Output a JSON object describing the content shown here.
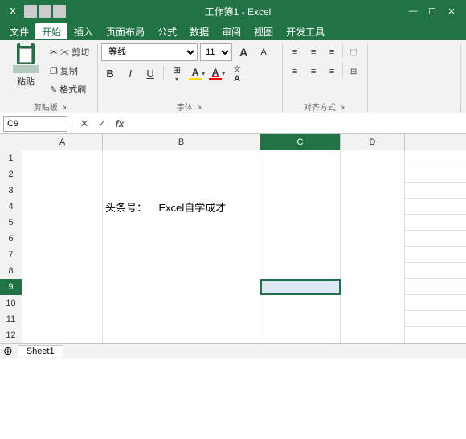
{
  "titlebar": {
    "text": "工作簿1 - Excel",
    "controls": [
      "—",
      "☐",
      "✕"
    ]
  },
  "menubar": {
    "items": [
      "文件",
      "开始",
      "插入",
      "页面布局",
      "公式",
      "数据",
      "审阅",
      "视图",
      "开发工具"
    ],
    "active": 1
  },
  "ribbon": {
    "clipboard": {
      "label": "剪贴板",
      "paste_label": "粘贴",
      "cut_label": "✂ 剪切",
      "copy_label": "☐ 复制",
      "format_label": "✎ 格式刷"
    },
    "font": {
      "label": "字体",
      "font_name": "等线",
      "font_size": "11",
      "bold": "B",
      "italic": "I",
      "underline": "U",
      "border_btn": "⊞",
      "fill_btn": "A",
      "color_btn": "A",
      "increase_size": "A",
      "decrease_size": "A"
    },
    "alignment": {
      "label": "对齐方式",
      "align_top": "≡",
      "align_mid": "≡",
      "align_bot": "≡",
      "align_left": "≡",
      "align_center": "≡",
      "align_right": "≡"
    }
  },
  "formulabar": {
    "cell_ref": "C9",
    "cancel": "✕",
    "confirm": "✓",
    "function_btn": "fx",
    "formula_value": ""
  },
  "columns": {
    "headers": [
      "A",
      "B",
      "C",
      "D"
    ],
    "widths": [
      100,
      196,
      100,
      80
    ]
  },
  "rows": [
    {
      "num": "1",
      "cells": [
        "",
        "",
        "",
        ""
      ]
    },
    {
      "num": "2",
      "cells": [
        "",
        "",
        "",
        ""
      ]
    },
    {
      "num": "3",
      "cells": [
        "",
        "",
        "",
        ""
      ]
    },
    {
      "num": "4",
      "cells": [
        "",
        "头条号：    Excel自学成才",
        "",
        ""
      ]
    },
    {
      "num": "5",
      "cells": [
        "",
        "",
        "",
        ""
      ]
    },
    {
      "num": "6",
      "cells": [
        "",
        "",
        "",
        ""
      ]
    },
    {
      "num": "7",
      "cells": [
        "",
        "",
        "",
        ""
      ]
    },
    {
      "num": "8",
      "cells": [
        "",
        "",
        "",
        ""
      ]
    },
    {
      "num": "9",
      "cells": [
        "",
        "",
        "",
        ""
      ]
    },
    {
      "num": "10",
      "cells": [
        "",
        "",
        "",
        ""
      ]
    },
    {
      "num": "11",
      "cells": [
        "",
        "",
        "",
        ""
      ]
    },
    {
      "num": "12",
      "cells": [
        "",
        "",
        "",
        ""
      ]
    }
  ],
  "selected_cell": "C9",
  "sheet_tab": "Sheet1"
}
